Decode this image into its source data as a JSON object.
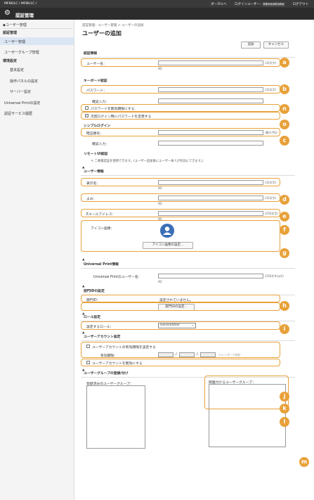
{
  "topbar": {
    "device": "MF6K/LC / MF8K/LC /",
    "portal": "ポータルへ",
    "login_user_label": "ログインユーザー：",
    "login_user": "Administrator",
    "logout": "ログアウト"
  },
  "titlebar": {
    "title": "認証管理"
  },
  "sidebar": {
    "back": "◆ユーザー管理",
    "sec_auth": "認証管理",
    "user_mgmt": "ユーザー管理",
    "group_mgmt": "ユーザーグループ管理",
    "sec_env": "環境設定",
    "basic": "基本設定",
    "panel": "操作パネルの設定",
    "server": "サーバー設定",
    "uprint": "Universal Printの設定",
    "auth_log": "認証サービス履歴"
  },
  "main": {
    "breadcrumb": "認証管理：ユーザー管理 > ユーザーの追加",
    "title": "ユーザーの追加",
    "add_button": "追加",
    "cancel_button": "キャンセル",
    "auth_info": {
      "heading": "認証情報",
      "username_label": "ユーザー名：",
      "username_hint": "(32文字)",
      "username_note": "(K)"
    },
    "keyboard_auth": {
      "heading": "キーボード認証",
      "password_label": "パスワード：",
      "password_hint": "(32文字)",
      "confirm_label": "確認入力：",
      "disable_password": "パスワードを無効期限にする",
      "change_next_login": "次回ログイン時にパスワードを変更する"
    },
    "simple_login": {
      "heading": "シンプルログイン",
      "pin_label": "暗証番号：",
      "pin_hint": "(最大7桁)",
      "confirm_label": "確認入力："
    },
    "remote_ui": {
      "heading": "リモートUI認証",
      "note": "＊ 二要素認証を使用できます。(ユーザー追加後にユーザー本人が有効にできます。)"
    },
    "user_info": {
      "heading": "ユーザー情報",
      "display_name_label": "表示名：",
      "display_name_hint": "(32文字)",
      "display_name_note": "(K)",
      "reading_label": "よみ：",
      "reading_hint": "(32文字)",
      "reading_note": "(K)",
      "email_label": "Eメールアドレス：",
      "email_hint": "(256文字)",
      "email_note": "(K)",
      "icon_label": "アイコン画像：",
      "icon_button": "アイコン画像の設定..."
    },
    "uprint": {
      "heading": "Universal Print情報",
      "user_label": "Universal Printのユーザー名：",
      "user_hint": "(256文字以内)",
      "user_note": "(K)"
    },
    "dept": {
      "heading": "部門IDの設定",
      "dept_label": "部門ID：",
      "dept_value": "設定されていません。",
      "dept_button": "部門IDの設定..."
    },
    "role": {
      "heading": "ロール設定",
      "role_label": "設定するロール：",
      "role_value": "GeneralUser"
    },
    "account": {
      "heading": "ユーザーアカウント設定",
      "expiry_check": "ユーザーアカウントの有効期限を設定する",
      "expiry_label": "有効期限：",
      "calendar_hint": "カレンダーで指定",
      "disable_account": "ユーザーアカウントを無効にする"
    },
    "group": {
      "heading": "ユーザーグループの登録/付け",
      "registered_label": "登録済みのユーザーグループ：",
      "assign_label": "関連付けるユーザーグループ："
    },
    "up_icon": "▲"
  },
  "badges": [
    "a",
    "b",
    "n",
    "o",
    "c",
    "d",
    "e",
    "f",
    "g",
    "h",
    "i",
    "j",
    "k",
    "l",
    "m"
  ],
  "accent_color": "#e8a13a"
}
